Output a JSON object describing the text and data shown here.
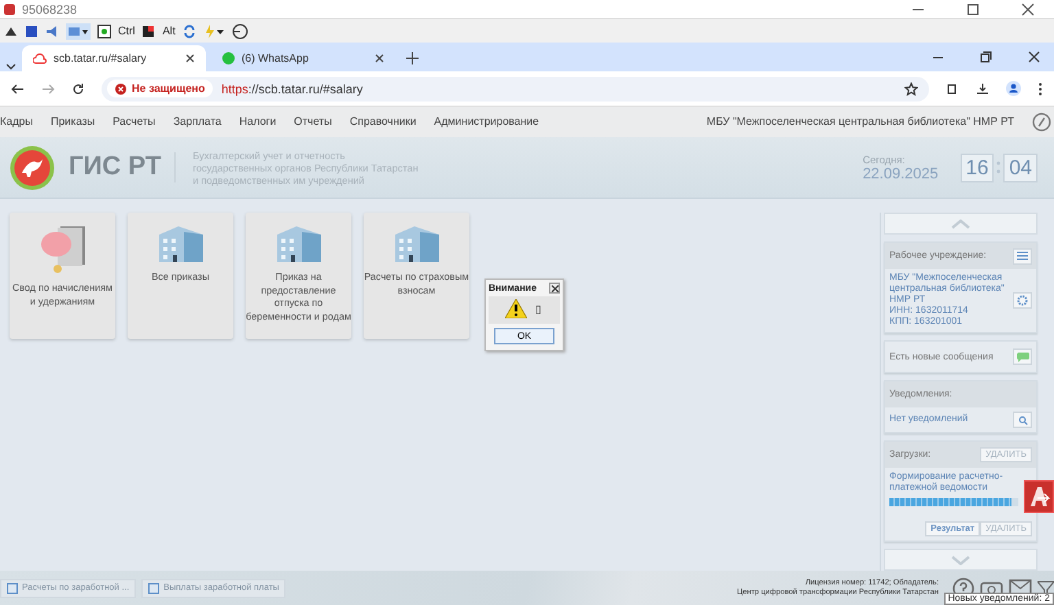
{
  "os_window": {
    "title": "95068238"
  },
  "toolbar": {
    "labels": [
      "Ctrl",
      "Alt"
    ]
  },
  "browser": {
    "tabs": [
      {
        "title": "scb.tatar.ru/#salary",
        "selected": true
      },
      {
        "title": "(6) WhatsApp",
        "selected": false
      }
    ],
    "security": "Не защищено",
    "url_scheme": "https",
    "url_rest": "://scb.tatar.ru/#salary"
  },
  "menu": {
    "items": [
      "Кадры",
      "Приказы",
      "Расчеты",
      "Зарплата",
      "Налоги",
      "Отчеты",
      "Справочники",
      "Администрирование"
    ],
    "organization": "МБУ \"Межпоселенческая центральная библиотека\" НМР РТ"
  },
  "header": {
    "logo_text": "ГИС РТ",
    "subtitle": [
      "Бухгалтерский учет и отчетность",
      "государственных органов Республики Татарстан",
      "и подведомственных им учреждений"
    ],
    "today_label": "Сегодня:",
    "date": "22.09.2025",
    "hours": "16",
    "minutes": "04"
  },
  "tiles": [
    {
      "label": "Свод по начислениям и удержаниям",
      "kind": "piggy"
    },
    {
      "label": "Все приказы",
      "kind": "building"
    },
    {
      "label": "Приказ на предоставление отпуска по беременности и родам",
      "kind": "building"
    },
    {
      "label": "Расчеты по страховым взносам",
      "kind": "building"
    }
  ],
  "dialog": {
    "title": "Внимание",
    "message": "▯",
    "ok": "OK"
  },
  "sidebar": {
    "org_panel": {
      "title": "Рабочее учреждение:",
      "lines": [
        "МБУ \"Межпоселенческая",
        "центральная библиотека\"",
        "НМР РТ",
        "ИНН: 1632011714",
        "КПП: 163201001"
      ]
    },
    "messages": "Есть новые сообщения",
    "notifications": {
      "title": "Уведомления:",
      "text": "Нет уведомлений"
    },
    "downloads": {
      "title": "Загрузки:",
      "delete": "УДАЛИТЬ",
      "items": [
        {
          "name": "Формирование расчетно-платежной ведомости",
          "level": 0.95,
          "result": "Результат",
          "delete": "УДАЛИТЬ"
        }
      ]
    }
  },
  "footer": {
    "tasks": [
      "Расчеты по заработной ...",
      "Выплаты заработной платы"
    ],
    "license": [
      "Лицензия номер: 11742; Обладатель:",
      "Центр цифровой трансформации Республики Татарстан"
    ],
    "tooltip": "Новых уведомлений: 2"
  }
}
